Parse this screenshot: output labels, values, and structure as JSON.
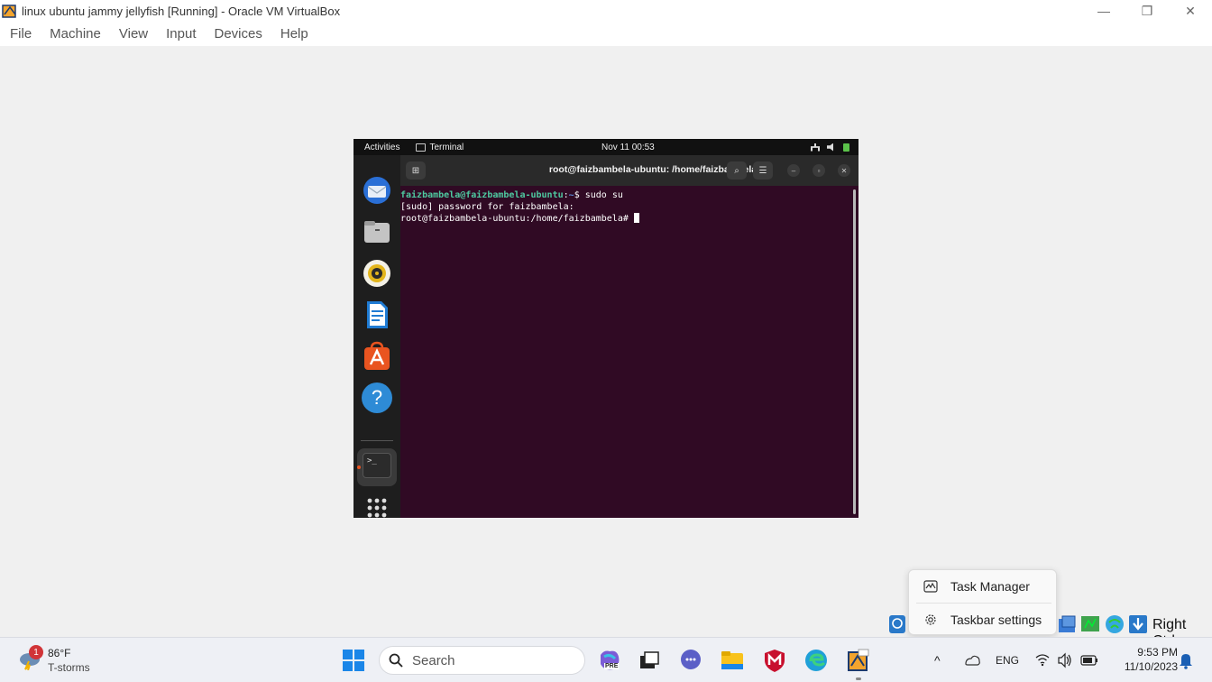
{
  "window": {
    "title": "linux ubuntu jammy jellyfish [Running] - Oracle VM VirtualBox",
    "controls": {
      "minimize": "—",
      "restore": "❐",
      "close": "✕"
    }
  },
  "menubar": {
    "items": [
      "File",
      "Machine",
      "View",
      "Input",
      "Devices",
      "Help"
    ]
  },
  "vm": {
    "topbar": {
      "activities": "Activities",
      "app": "Terminal",
      "clock": "Nov 11  00:53"
    },
    "dock": {
      "icons": [
        "thunderbird-icon",
        "files-icon",
        "rhythmbox-icon",
        "writer-icon",
        "software-icon",
        "help-icon",
        "terminal-icon",
        "app-grid-icon"
      ],
      "help_glyph": "?",
      "terminal_glyph": ">_"
    },
    "terminal": {
      "title": "root@faizbambela-ubuntu: /home/faizbambela",
      "newtab_glyph": "⊞",
      "search_glyph": "⌕",
      "menu_glyph": "☰",
      "min_glyph": "–",
      "max_glyph": "▫",
      "close_glyph": "✕",
      "lines": [
        {
          "user": "faizbambela@faizbambela-ubuntu",
          "sep": ":",
          "path": "~",
          "rest": "$ sudo su"
        },
        {
          "text": "[sudo] password for faizbambela:"
        },
        {
          "text": "root@faizbambela-ubuntu:/home/faizbambela# "
        }
      ]
    }
  },
  "context_menu": {
    "items": [
      {
        "label": "Task Manager",
        "icon": "task-manager-icon"
      },
      {
        "label": "Taskbar settings",
        "icon": "gear-icon"
      }
    ]
  },
  "host_key": "Right Ctrl",
  "taskbar": {
    "weather": {
      "badge": "1",
      "temp": "86°F",
      "condition": "T-storms"
    },
    "search": {
      "label": "Search"
    },
    "apps": [
      "copilot-icon",
      "task-view-icon",
      "teams-chat-icon",
      "file-explorer-icon",
      "mcafee-icon",
      "edge-icon",
      "virtualbox-icon"
    ],
    "copilot_badge": "PRE",
    "tray": {
      "chevron": "^",
      "language": "ENG"
    },
    "clock": {
      "time": "9:53 PM",
      "date": "11/10/2023"
    }
  }
}
